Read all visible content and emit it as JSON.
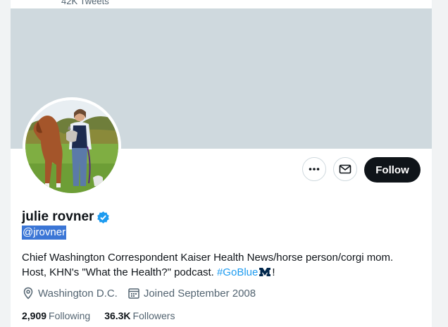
{
  "profile": {
    "tweet_count": "42K Tweets",
    "display_name": "julie rovner",
    "handle": "@jrovner",
    "bio_text": "Chief Washington Correspondent Kaiser Health News/horse person/corgi mom. Host, KHN's \"What the Health?\" podcast. ",
    "bio_hashtag": "#GoBlue",
    "bio_end": "!",
    "location": "Washington D.C.",
    "joined": "Joined September 2008",
    "following_count": "2,909",
    "following_label": "Following",
    "followers_count": "36.3K",
    "followers_label": "Followers"
  },
  "actions": {
    "follow_label": "Follow"
  },
  "icons": {
    "more": "more-horizontal-icon",
    "message": "envelope-icon",
    "verified": "verified-badge-icon",
    "location": "location-pin-icon",
    "calendar": "calendar-icon",
    "umich": "block-m-emoji"
  },
  "colors": {
    "accent": "#1d9bf0",
    "follow_bg": "#0f1419",
    "banner": "#cfd9de",
    "selection": "#3b76d6"
  }
}
